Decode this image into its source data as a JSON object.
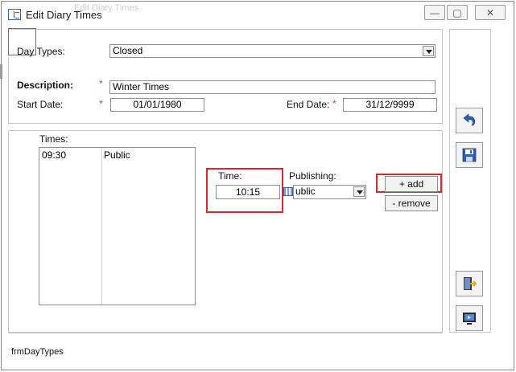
{
  "window": {
    "title": "Edit Diary Times",
    "ghost_title": "Edit Diary Times",
    "controls": {
      "minimize": "—",
      "maximize": "▢",
      "close": "✕"
    }
  },
  "form": {
    "day_types": {
      "label": "Day Types:",
      "value": "Closed"
    },
    "description": {
      "label": "Description:",
      "required": "*",
      "value": "Winter Times"
    },
    "start_date": {
      "label": "Start Date:",
      "required": "*",
      "value": "01/01/1980"
    },
    "end_date": {
      "label": "End Date:",
      "required": "*",
      "value": "31/12/9999"
    }
  },
  "times": {
    "label": "Times:",
    "rows": [
      {
        "time": "09:30",
        "publishing": "Public"
      }
    ]
  },
  "time_entry": {
    "label": "Time:",
    "value": "10:15"
  },
  "publishing": {
    "label": "Publishing:",
    "value": "ublic"
  },
  "buttons": {
    "add": "+ add",
    "remove": "- remove"
  },
  "footer": {
    "form_name": "frmDayTypes"
  },
  "colors": {
    "highlight": "#e0262b",
    "required": "#d4358e",
    "accent": "#3b63a8"
  }
}
